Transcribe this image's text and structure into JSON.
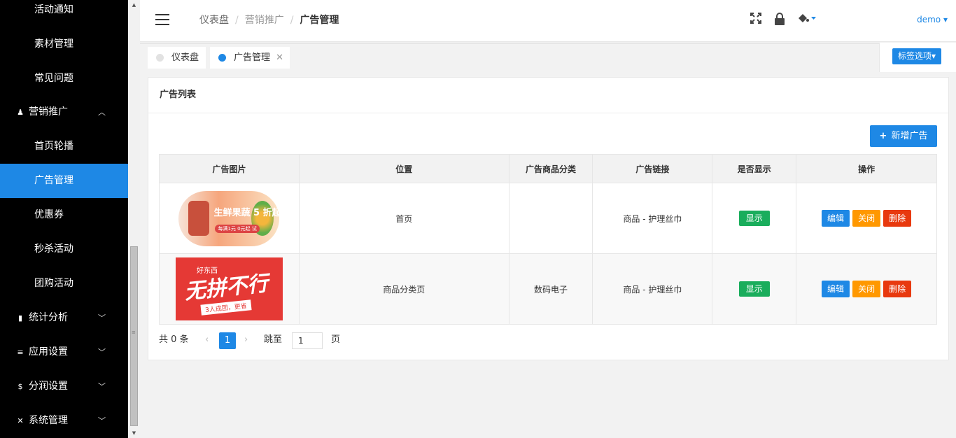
{
  "sidebar": {
    "items": [
      {
        "label": "活动通知",
        "type": "sub"
      },
      {
        "label": "素材管理",
        "type": "sub"
      },
      {
        "label": "常见问题",
        "type": "sub"
      },
      {
        "label": "营销推广",
        "type": "group",
        "icon": "playstation-icon",
        "expanded": true
      },
      {
        "label": "首页轮播",
        "type": "sub"
      },
      {
        "label": "广告管理",
        "type": "sub",
        "active": true
      },
      {
        "label": "优惠券",
        "type": "sub"
      },
      {
        "label": "秒杀活动",
        "type": "sub"
      },
      {
        "label": "团购活动",
        "type": "sub"
      },
      {
        "label": "统计分析",
        "type": "group",
        "icon": "bar-chart-icon"
      },
      {
        "label": "应用设置",
        "type": "group",
        "icon": "list-icon"
      },
      {
        "label": "分润设置",
        "type": "group",
        "icon": "dollar-icon"
      },
      {
        "label": "系统管理",
        "type": "group",
        "icon": "tools-icon"
      }
    ]
  },
  "header": {
    "breadcrumb": [
      "仪表盘",
      "营销推广",
      "广告管理"
    ],
    "user": "demo"
  },
  "tabs": [
    {
      "label": "仪表盘",
      "active": false
    },
    {
      "label": "广告管理",
      "active": true,
      "closable": true
    }
  ],
  "tab_options_label": "标签选项",
  "card": {
    "title": "广告列表",
    "add_button": "新增广告"
  },
  "table": {
    "columns": [
      "广告图片",
      "位置",
      "广告商品分类",
      "广告链接",
      "是否显示",
      "操作"
    ],
    "rows": [
      {
        "image": {
          "headline": "生鲜果蔬 5 折起",
          "sub": "每满1元 0元起 试"
        },
        "position": "首页",
        "category": "",
        "link": "商品 - 护理丝巾",
        "display": "显示",
        "actions": [
          "编辑",
          "关闭",
          "删除"
        ]
      },
      {
        "image": {
          "top": "好东西",
          "headline": "无拼不行",
          "sub": "3人成团，更省"
        },
        "position": "商品分类页",
        "category": "数码电子",
        "link": "商品 - 护理丝巾",
        "display": "显示",
        "actions": [
          "编辑",
          "关闭",
          "删除"
        ]
      }
    ]
  },
  "pagination": {
    "total_text": "共 0 条",
    "current": "1",
    "jump_label": "跳至",
    "jump_value": "1",
    "unit": "页"
  },
  "colors": {
    "accent": "#1e88e5",
    "sidebar_bg": "#000000",
    "green": "#1aad5c",
    "orange": "#ff9800",
    "red": "#e8390e"
  }
}
